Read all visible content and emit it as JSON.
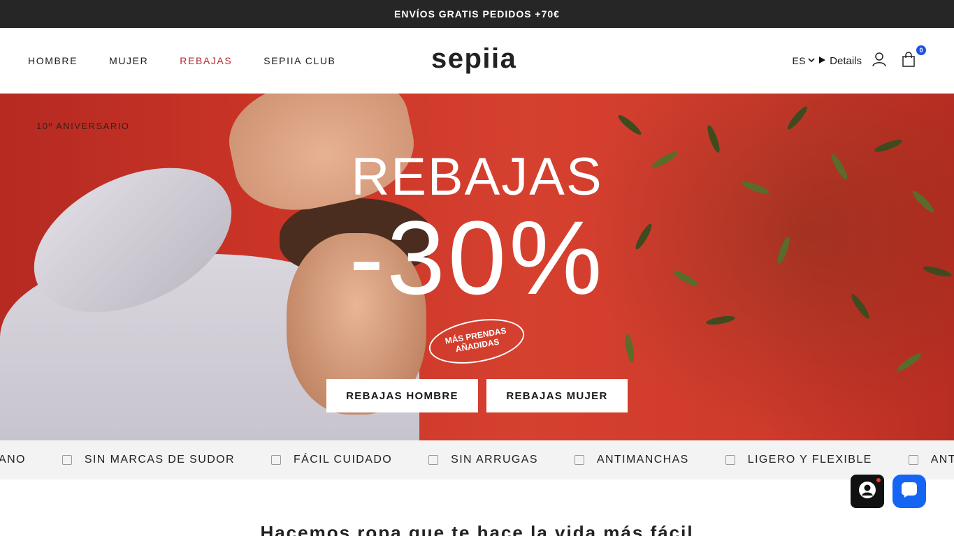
{
  "announcement": {
    "text": "ENVÍOS GRATIS PEDIDOS +70€"
  },
  "header": {
    "nav": [
      {
        "label": "HOMBRE"
      },
      {
        "label": "MUJER"
      },
      {
        "label": "REBAJAS"
      },
      {
        "label": "SEPIIA CLUB"
      }
    ],
    "logo": "sepiia",
    "language": "ES",
    "details_label": "Details",
    "cart_count": "0",
    "icons": [
      "chevron-down-icon",
      "triangle-right-icon",
      "user-icon",
      "shopping-bag-icon"
    ]
  },
  "hero": {
    "eyebrow": "10º ANIVERSARIO",
    "headline": "REBAJAS",
    "discount": "-30%",
    "stamp": "MÁS PRENDAS AÑADIDAS",
    "cta_men": "REBAJAS HOMBRE",
    "cta_women": "REBAJAS MUJER"
  },
  "ticker": {
    "items": [
      {
        "label": "ANO",
        "icon": ""
      },
      {
        "label": "SIN MARCAS DE SUDOR",
        "icon": "sweat-icon"
      },
      {
        "label": "FÁCIL CUIDADO",
        "icon": "easy-care-icon"
      },
      {
        "label": "SIN ARRUGAS",
        "icon": "no-wrinkle-icon"
      },
      {
        "label": "ANTIMANCHAS",
        "icon": "stain-icon"
      },
      {
        "label": "LIGERO Y FLEXIBLE",
        "icon": "flexible-icon"
      },
      {
        "label": "ANTIBA",
        "icon": "antibacterial-icon"
      }
    ]
  },
  "intro": {
    "text": "Hacemos ropa que te hace la vida más fácil"
  },
  "colors": {
    "sale_red": "#b3282d",
    "announce_bg": "#262626",
    "accent_blue": "#1565f4",
    "badge_blue": "#1e50e6"
  }
}
